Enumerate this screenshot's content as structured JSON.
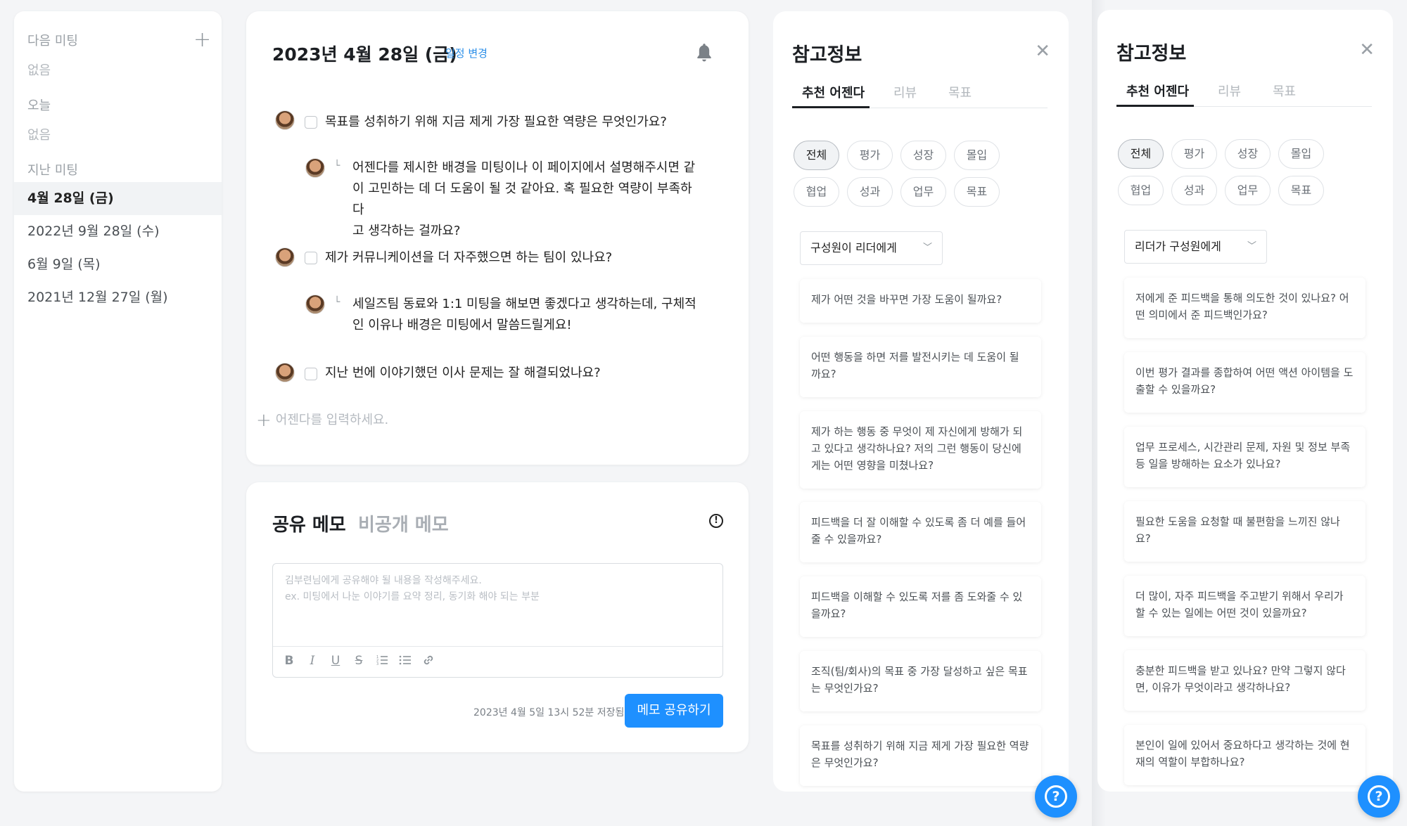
{
  "sidebar": {
    "next_meeting_label": "다음 미팅",
    "next_meeting_empty": "없음",
    "add_icon": "plus-icon",
    "today_label": "오늘",
    "today_empty": "없음",
    "past_label": "지난 미팅",
    "past_items": [
      "4월 28일 (금)",
      "2022년 9월 28일 (수)",
      "6월 9일 (목)",
      "2021년 12월 27일 (월)"
    ]
  },
  "agenda": {
    "date": "2023년 4월 28일 (금)",
    "schedule_change": "일정 변경",
    "bell_icon": "bell-icon",
    "items": [
      {
        "question": "목표를 성취하기 위해 지금 제게 가장 필요한 역량은 무엇인가요?",
        "reply_lines": [
          "어젠다를 제시한 배경을 미팅이나 이 페이지에서 설명해주시면 같",
          "이 고민하는 데 더 도움이 될 것 같아요. 혹 필요한 역량이 부족하다",
          "고 생각하는 걸까요?"
        ]
      },
      {
        "question": "제가 커뮤니케이션을 더 자주했으면 하는 팀이 있나요?",
        "reply_lines": [
          "세일즈팀 동료와 1:1 미팅을 해보면 좋겠다고 생각하는데, 구체적",
          "인 이유나 배경은 미팅에서 말씀드릴게요!"
        ]
      },
      {
        "question": "지난 번에 이야기했던 이사 문제는 잘 해결되었나요?",
        "reply_lines": []
      }
    ],
    "reply_mark": "└",
    "add_placeholder": "어젠다를 입력하세요."
  },
  "memo": {
    "tab_shared": "공유 메모",
    "tab_private": "비공개 메모",
    "info_icon": "info-icon",
    "placeholder_line1": "김부련님에게 공유해야 될 내용을 작성해주세요.",
    "placeholder_line2": "ex. 미팅에서 나눈 이야기를 요약 정리, 동기화 해야 되는 부분",
    "toolbar": [
      "B",
      "I",
      "U",
      "S",
      "ordered-list-icon",
      "bullet-list-icon",
      "link-icon"
    ],
    "saved_text": "2023년 4월 5일 13시 52분 저장됨",
    "share_button": "메모 공유하기"
  },
  "ref_left": {
    "title": "참고정보",
    "close_icon": "close-icon",
    "tabs": [
      "추천 어젠다",
      "리뷰",
      "목표"
    ],
    "chips": [
      "전체",
      "평가",
      "성장",
      "몰입",
      "협업",
      "성과",
      "업무",
      "목표"
    ],
    "dropdown": "구성원이 리더에게",
    "questions": [
      "제가 어떤 것을 바꾸면 가장 도움이 될까요?",
      "어떤 행동을 하면 저를 발전시키는 데 도움이 될 까요?",
      "제가 하는 행동 중 무엇이 제 자신에게 방해가 되고 있다고 생각하나요? 저의 그런 행동이 당신에게는 어떤 영향을 미쳤나요?",
      "피드백을 더 잘 이해할 수 있도록 좀 더 예를 들어 줄 수 있을까요?",
      "피드백을 이해할 수 있도록 저를 좀 도와줄 수 있을까요?",
      "조직(팀/회사)의 목표 중 가장 달성하고 싶은 목표는 무엇인가요?",
      "목표를 성취하기 위해 지금 제게 가장 필요한 역량은 무엇인가요?"
    ]
  },
  "ref_right": {
    "title": "참고정보",
    "close_icon": "close-icon",
    "tabs": [
      "추천 어젠다",
      "리뷰",
      "목표"
    ],
    "chips": [
      "전체",
      "평가",
      "성장",
      "몰입",
      "협업",
      "성과",
      "업무",
      "목표"
    ],
    "dropdown": "리더가 구성원에게",
    "questions": [
      "저에게 준 피드백을 통해 의도한 것이 있나요? 어떤 의미에서 준 피드백인가요?",
      "이번 평가 결과를 종합하여 어떤 액션 아이템을 도출할 수 있을까요?",
      "업무 프로세스, 시간관리 문제, 자원 및 정보 부족 등 일을 방해하는 요소가 있나요?",
      "필요한 도움을 요청할 때 불편함을 느끼진 않나요?",
      "더 많이, 자주 피드백을 주고받기 위해서 우리가 할 수 있는 일에는 어떤 것이 있을까요?",
      "충분한 피드백을 받고 있나요? 만약 그렇지 않다면, 이유가 무엇이라고 생각하나요?",
      "본인이 일에 있어서 중요하다고 생각하는 것에 현재의 역할이 부합하나요?"
    ]
  },
  "help_icon": "help-icon",
  "colors": {
    "accent": "#1e90ff",
    "link": "#2a8ee8"
  }
}
